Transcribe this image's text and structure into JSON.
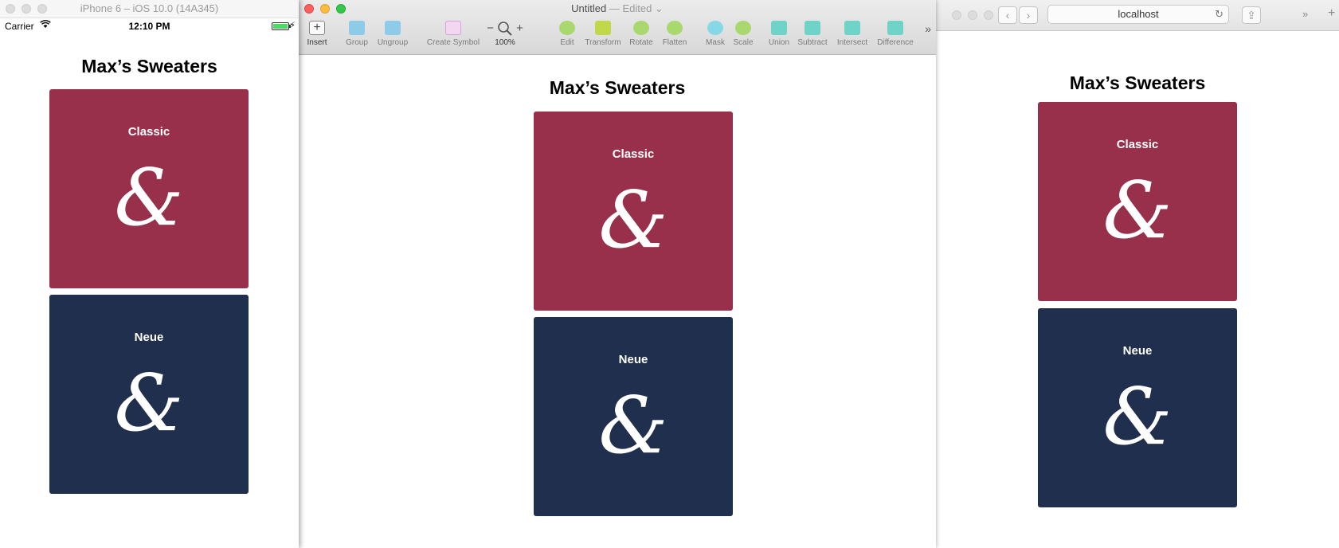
{
  "colors": {
    "classic": "#98304b",
    "neue": "#212f4e"
  },
  "simulator": {
    "window_title": "iPhone 6 – iOS 10.0 (14A345)",
    "status": {
      "carrier": "Carrier",
      "wifi_icon": "wifi-icon",
      "time": "12:10 PM",
      "battery_icon": "battery-icon"
    },
    "app": {
      "title": "Max’s Sweaters",
      "cards": [
        {
          "label": "Classic",
          "glyph": "&"
        },
        {
          "label": "Neue",
          "glyph": "&"
        }
      ]
    }
  },
  "sketch": {
    "title": "Untitled",
    "edited": " — Edited ⌄",
    "toolbar": {
      "insert": "Insert",
      "group": "Group",
      "ungroup": "Ungroup",
      "create_symbol": "Create Symbol",
      "zoom_minus": "−",
      "zoom_plus": "+",
      "zoom_level": "100%",
      "edit": "Edit",
      "transform": "Transform",
      "rotate": "Rotate",
      "flatten": "Flatten",
      "mask": "Mask",
      "scale": "Scale",
      "union": "Union",
      "subtract": "Subtract",
      "intersect": "Intersect",
      "difference": "Difference",
      "more": "»"
    },
    "artboard": {
      "title": "Max’s Sweaters",
      "cards": [
        {
          "label": "Classic",
          "glyph": "&"
        },
        {
          "label": "Neue",
          "glyph": "&"
        }
      ]
    }
  },
  "safari": {
    "back": "‹",
    "forward": "›",
    "address": "localhost",
    "reload": "↻",
    "share": "⇪",
    "more": "»",
    "new_tab": "+",
    "page": {
      "title": "Max’s Sweaters",
      "cards": [
        {
          "label": "Classic",
          "glyph": "&"
        },
        {
          "label": "Neue",
          "glyph": "&"
        }
      ]
    }
  }
}
